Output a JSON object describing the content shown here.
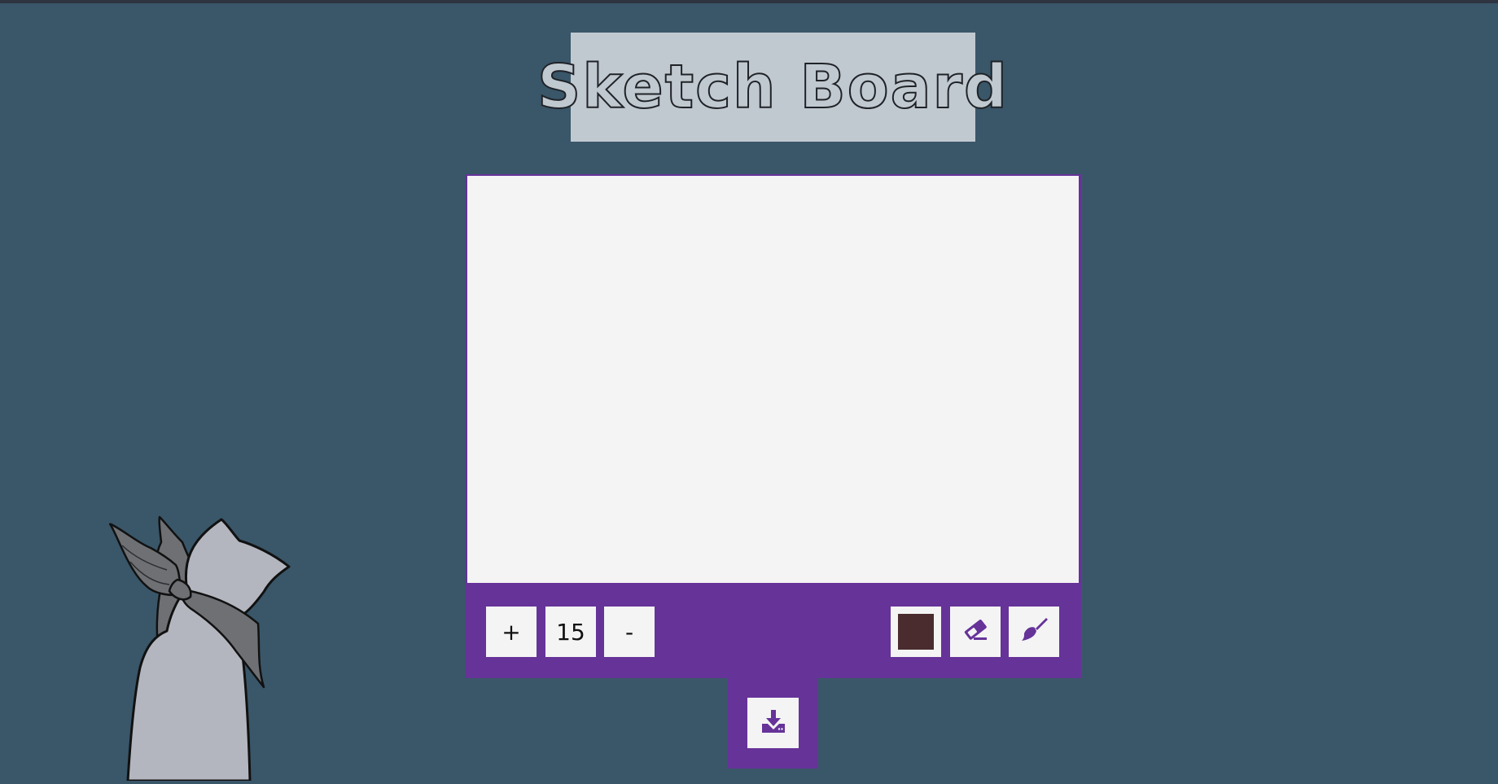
{
  "title": "Sketch Board",
  "toolbar": {
    "increase_label": "+",
    "size_value": "15",
    "decrease_label": "-",
    "current_color": "#4a2c2e",
    "eraser_icon": "eraser-icon",
    "brush_icon": "brush-icon"
  },
  "download": {
    "icon": "download-icon"
  },
  "colors": {
    "background": "#3a5669",
    "accent": "#663399",
    "canvas": "#f4f4f4",
    "title_box": "#c1c9d0"
  }
}
